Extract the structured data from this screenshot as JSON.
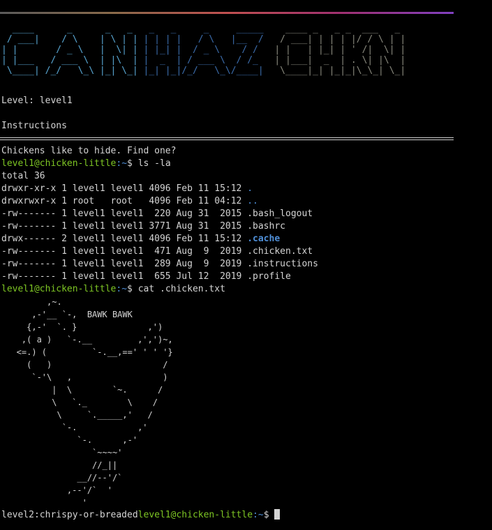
{
  "banner": {
    "can": [
      "  ____      _      _   _ ",
      " / ___|    / \\    | \\ | |",
      "| |       / _ \\   |  \\| |",
      "| |___   / ___ \\  | |\\  |",
      " \\____| /_/   \\_\\ |_| \\_|"
    ],
    "haz": [
      "  _   _     _     _____ ",
      " | | | |   / \\   |__  / ",
      " | |_| |  / _ \\    / /  ",
      " |  _  | / ___ \\  / /_  ",
      " |_| |_|/_/   \\_\\/____| "
    ],
    "chkn": [
      "   ____ _   _ _  ___   _ ",
      "  / ___| | | | |/ / \\ | |",
      " | |   | |_| | ' /|  \\| |",
      " | |___|  _  | . \\| |\\  |",
      "  \\____|_| |_|_|\\_\\_| \\_|"
    ]
  },
  "level_line": "Level: level1",
  "instructions_heading": "Instructions",
  "hint": "Chickens like to hide. Find one?",
  "prompt": {
    "user_host": "level1@chicken-little",
    "path": ":~",
    "symbol": "$ "
  },
  "commands": {
    "first": "ls -la",
    "second": "cat .chicken.txt"
  },
  "listing": {
    "total": "total 36",
    "rows": [
      {
        "meta": "drwxr-xr-x 1 level1 level1 4096 Feb 11 15:12 ",
        "name": ".",
        "kind": "dir"
      },
      {
        "meta": "drwxrwxr-x 1 root   root   4096 Feb 11 04:12 ",
        "name": "..",
        "kind": "dir"
      },
      {
        "meta": "-rw------- 1 level1 level1  220 Aug 31  2015 ",
        "name": ".bash_logout",
        "kind": "file"
      },
      {
        "meta": "-rw------- 1 level1 level1 3771 Aug 31  2015 ",
        "name": ".bashrc",
        "kind": "file"
      },
      {
        "meta": "drwx------ 2 level1 level1 4096 Feb 11 15:12 ",
        "name": ".cache",
        "kind": "dir-bold"
      },
      {
        "meta": "-rw------- 1 level1 level1  471 Aug  9  2019 ",
        "name": ".chicken.txt",
        "kind": "file"
      },
      {
        "meta": "-rw------- 1 level1 level1  289 Aug  9  2019 ",
        "name": ".instructions",
        "kind": "file"
      },
      {
        "meta": "-rw------- 1 level1 level1  655 Jul 12  2019 ",
        "name": ".profile",
        "kind": "file"
      }
    ]
  },
  "chicken_art": "         ,~.\n      ,-'__ `-,  BAWK BAWK\n     {,-'  `. }              ,')\n    ,( a )   `-.__         ,',')~,\n   <=.) (         `-.__,==' ' ' '}\n     (   )                      /\n      `-'\\   ,                  )\n          |  \\        `~.      /\n          \\   `._        \\    /\n           \\     `._____,'   /\n            `-.            ,'\n               `-.      ,-'\n                  `~~~~'\n                  //_||\n               __//--'/`\n             ,--'/`  '\n                '",
  "bottom": {
    "password": "level2:chrispy-or-breaded",
    "user_host": "level1@chicken-little",
    "path": ":~",
    "symbol": "$ "
  },
  "colors": {
    "prompt_user": "#7ec624",
    "directory": "#4f8fd8",
    "text": "#d4d4d4",
    "background": "#000000"
  }
}
